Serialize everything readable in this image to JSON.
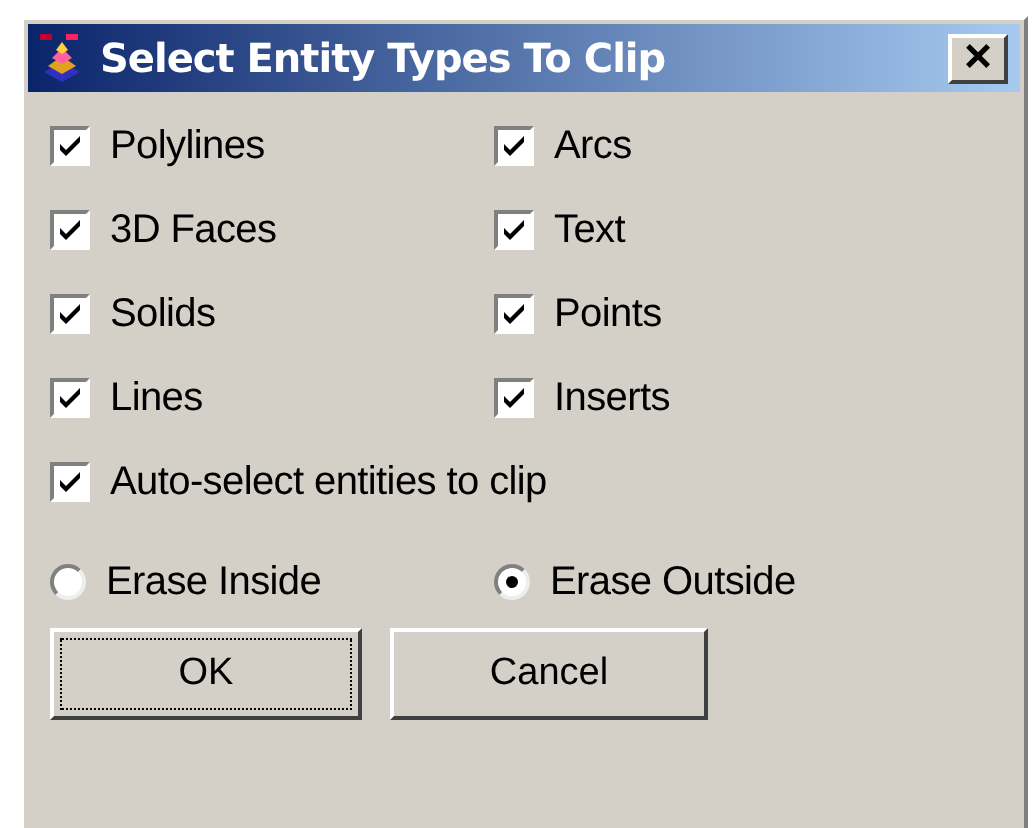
{
  "window": {
    "title": "Select Entity Types To Clip",
    "close": "×"
  },
  "entity_types": [
    {
      "label": "Polylines",
      "checked": true
    },
    {
      "label": "Arcs",
      "checked": true
    },
    {
      "label": "3D Faces",
      "checked": true
    },
    {
      "label": "Text",
      "checked": true
    },
    {
      "label": "Solids",
      "checked": true
    },
    {
      "label": "Points",
      "checked": true
    },
    {
      "label": "Lines",
      "checked": true
    },
    {
      "label": "Inserts",
      "checked": true
    }
  ],
  "auto_select": {
    "label": "Auto-select entities to clip",
    "checked": true
  },
  "erase_mode": [
    {
      "label": "Erase Inside",
      "selected": false
    },
    {
      "label": "Erase Outside",
      "selected": true
    }
  ],
  "buttons": [
    {
      "label": "OK",
      "focused": true
    },
    {
      "label": "Cancel",
      "focused": false
    }
  ]
}
